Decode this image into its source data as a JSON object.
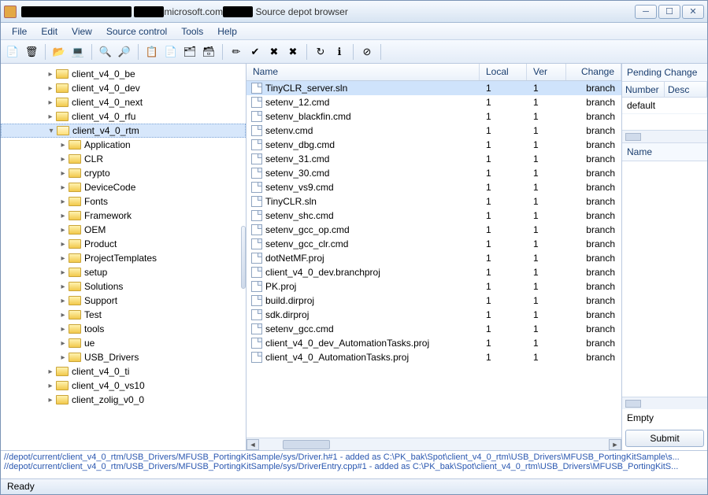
{
  "title": {
    "suffix": "microsoft.com",
    "app": "Source depot browser"
  },
  "menu": [
    "File",
    "Edit",
    "View",
    "Source control",
    "Tools",
    "Help"
  ],
  "tree": {
    "top": [
      {
        "label": "client_v4_0_be",
        "depth": 3
      },
      {
        "label": "client_v4_0_dev",
        "depth": 3
      },
      {
        "label": "client_v4_0_next",
        "depth": 3
      },
      {
        "label": "client_v4_0_rfu",
        "depth": 3
      }
    ],
    "selected": {
      "label": "client_v4_0_rtm",
      "depth": 3
    },
    "children": [
      "Application",
      "CLR",
      "crypto",
      "DeviceCode",
      "Fonts",
      "Framework",
      "OEM",
      "Product",
      "ProjectTemplates",
      "setup",
      "Solutions",
      "Support",
      "Test",
      "tools",
      "ue",
      "USB_Drivers"
    ],
    "after": [
      {
        "label": "client_v4_0_ti",
        "depth": 3
      },
      {
        "label": "client_v4_0_vs10",
        "depth": 3
      },
      {
        "label": "client_zolig_v0_0",
        "depth": 3
      }
    ]
  },
  "columns": {
    "name": "Name",
    "local": "Local",
    "ver": "Ver",
    "change": "Change"
  },
  "files": [
    {
      "name": "TinyCLR_server.sln",
      "local": "1",
      "ver": "1",
      "change": "branch",
      "sel": true
    },
    {
      "name": "setenv_12.cmd",
      "local": "1",
      "ver": "1",
      "change": "branch"
    },
    {
      "name": "setenv_blackfin.cmd",
      "local": "1",
      "ver": "1",
      "change": "branch"
    },
    {
      "name": "setenv.cmd",
      "local": "1",
      "ver": "1",
      "change": "branch"
    },
    {
      "name": "setenv_dbg.cmd",
      "local": "1",
      "ver": "1",
      "change": "branch"
    },
    {
      "name": "setenv_31.cmd",
      "local": "1",
      "ver": "1",
      "change": "branch"
    },
    {
      "name": "setenv_30.cmd",
      "local": "1",
      "ver": "1",
      "change": "branch"
    },
    {
      "name": "setenv_vs9.cmd",
      "local": "1",
      "ver": "1",
      "change": "branch"
    },
    {
      "name": "TinyCLR.sln",
      "local": "1",
      "ver": "1",
      "change": "branch"
    },
    {
      "name": "setenv_shc.cmd",
      "local": "1",
      "ver": "1",
      "change": "branch"
    },
    {
      "name": "setenv_gcc_op.cmd",
      "local": "1",
      "ver": "1",
      "change": "branch"
    },
    {
      "name": "setenv_gcc_clr.cmd",
      "local": "1",
      "ver": "1",
      "change": "branch"
    },
    {
      "name": "dotNetMF.proj",
      "local": "1",
      "ver": "1",
      "change": "branch"
    },
    {
      "name": "client_v4_0_dev.branchproj",
      "local": "1",
      "ver": "1",
      "change": "branch"
    },
    {
      "name": "PK.proj",
      "local": "1",
      "ver": "1",
      "change": "branch"
    },
    {
      "name": "build.dirproj",
      "local": "1",
      "ver": "1",
      "change": "branch"
    },
    {
      "name": "sdk.dirproj",
      "local": "1",
      "ver": "1",
      "change": "branch"
    },
    {
      "name": "setenv_gcc.cmd",
      "local": "1",
      "ver": "1",
      "change": "branch"
    },
    {
      "name": "client_v4_0_dev_AutomationTasks.proj",
      "local": "1",
      "ver": "1",
      "change": "branch"
    },
    {
      "name": "client_v4_0_AutomationTasks.proj",
      "local": "1",
      "ver": "1",
      "change": "branch"
    }
  ],
  "right": {
    "headline": "Pending Change",
    "cols": [
      "Number",
      "Desc"
    ],
    "row": "default",
    "nameHead": "Name",
    "empty": "Empty",
    "submit": "Submit"
  },
  "log": [
    "//depot/current/client_v4_0_rtm/USB_Drivers/MFUSB_PortingKitSample/sys/Driver.h#1 - added as C:\\PK_bak\\Spot\\client_v4_0_rtm\\USB_Drivers\\MFUSB_PortingKitSample\\s...",
    "//depot/current/client_v4_0_rtm/USB_Drivers/MFUSB_PortingKitSample/sys/DriverEntry.cpp#1 - added as C:\\PK_bak\\Spot\\client_v4_0_rtm\\USB_Drivers\\MFUSB_PortingKitS..."
  ],
  "status": "Ready",
  "toolbar_icons": [
    "📄",
    "🗑",
    "📂",
    "💻",
    "🔍",
    "🔎",
    "📋",
    "📄",
    "🗂",
    "🗃",
    "✏",
    "✔",
    "✖",
    "✖",
    "↻",
    "ℹ",
    "⊘"
  ]
}
